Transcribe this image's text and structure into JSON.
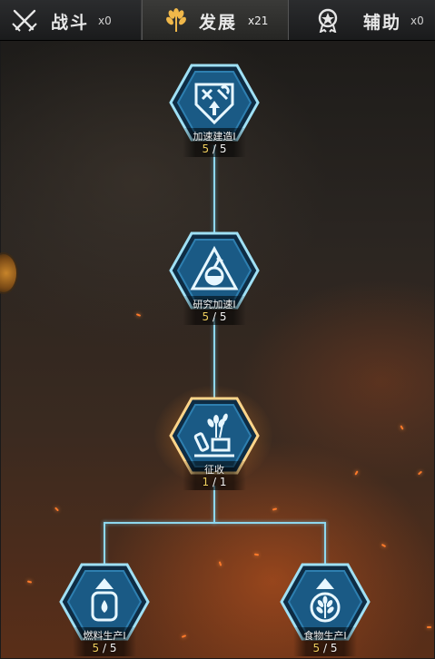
{
  "tabs": [
    {
      "label": "战斗",
      "count": "x0",
      "icon": "crossed-swords-icon"
    },
    {
      "label": "发展",
      "count": "x21",
      "icon": "wheat-icon",
      "active": true
    },
    {
      "label": "辅助",
      "count": "x0",
      "icon": "medal-icon"
    }
  ],
  "nodes": {
    "speed_build": {
      "label": "加速建造I",
      "current": "5",
      "max": "5",
      "icon": "tools-upgrade-icon"
    },
    "research_speed": {
      "label": "研究加速I",
      "current": "5",
      "max": "5",
      "icon": "flask-icon"
    },
    "levy": {
      "label": "征收",
      "current": "1",
      "max": "1",
      "icon": "harvest-icon"
    },
    "fuel_production": {
      "label": "燃料生产I",
      "current": "5",
      "max": "5",
      "icon": "fuel-barrel-icon"
    },
    "food_production": {
      "label": "食物生产I",
      "current": "5",
      "max": "5",
      "icon": "wheat-icon"
    }
  },
  "colors": {
    "accent": "#8ed7ee",
    "progress": "#f0cf5e",
    "hex_fill": "#123a57"
  }
}
